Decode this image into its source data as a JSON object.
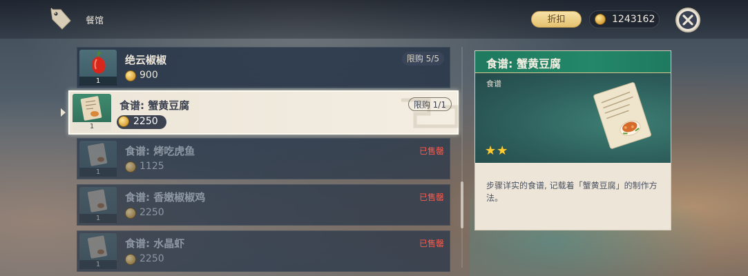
{
  "header": {
    "title": "餐馆",
    "discount_label": "折扣",
    "currency_amount": "1243162"
  },
  "shop_items": [
    {
      "name": "绝云椒椒",
      "price": "900",
      "quantity": "1",
      "limit": "限购 5/5",
      "status": "available"
    },
    {
      "name": "食谱: 蟹黄豆腐",
      "price": "2250",
      "quantity": "1",
      "limit": "限购 1/1",
      "status": "selected"
    },
    {
      "name": "食谱: 烤吃虎鱼",
      "price": "1125",
      "quantity": "1",
      "sold_out_label": "已售罄",
      "status": "sold_out"
    },
    {
      "name": "食谱: 香嫩椒椒鸡",
      "price": "2250",
      "quantity": "1",
      "sold_out_label": "已售罄",
      "status": "sold_out"
    },
    {
      "name": "食谱: 水晶虾",
      "price": "2250",
      "quantity": "1",
      "sold_out_label": "已售罄",
      "status": "sold_out"
    }
  ],
  "detail": {
    "title": "食谱: 蟹黄豆腐",
    "type": "食谱",
    "stars": 2,
    "star_glyph": "★",
    "description": "步骤详实的食谱, 记载着「蟹黄豆腐」的制作方法。"
  },
  "colors": {
    "accent_green": "#238768",
    "coin_gold": "#d9a23a",
    "sold_out_red": "#ff5b4d",
    "panel_cream": "#ece5d8"
  },
  "icons": {
    "shop": "tag-icon",
    "currency": "mora-coin-icon",
    "close": "close-icon",
    "item_1": "chili-pepper-icon",
    "recipe": "recipe-scroll-icon"
  }
}
